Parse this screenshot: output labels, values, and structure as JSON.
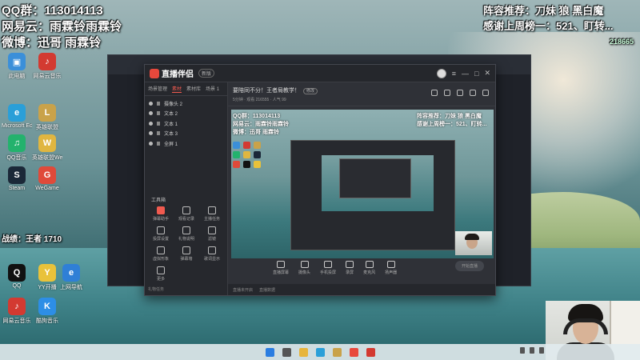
{
  "overlay": {
    "qq_group": "QQ群：113014113",
    "netease": "网易云：雨霖铃雨霖铃",
    "weibo": "微博：迅哥 雨霖铃",
    "lineup": "阵容推荐：刀妹 狼 黑白魔",
    "thanks": "感谢上周榜一：521、盯转...",
    "room_no": "218665"
  },
  "desktop_icons": [
    {
      "label": "此电脑",
      "color": "#3b8fd9",
      "glyph": "▣"
    },
    {
      "label": "网易云音乐",
      "color": "#d33a31",
      "glyph": "♪"
    },
    {
      "label": "Microsoft Edge",
      "color": "#2a9fd8",
      "glyph": "e"
    },
    {
      "label": "英雄联盟",
      "color": "#c9a24a",
      "glyph": "L"
    },
    {
      "label": "QQ音乐",
      "color": "#23b26d",
      "glyph": "♫"
    },
    {
      "label": "英雄联盟WeGame",
      "color": "#e0b640",
      "glyph": "W"
    },
    {
      "label": "Steam",
      "color": "#1b2838",
      "glyph": "S"
    },
    {
      "label": "WeGame",
      "color": "#e04a3a",
      "glyph": "G"
    },
    {
      "label": "QQ",
      "color": "#111111",
      "glyph": "Q"
    },
    {
      "label": "YY开播",
      "color": "#e9c23a",
      "glyph": "Y"
    },
    {
      "label": "上网导航",
      "color": "#2f7fd6",
      "glyph": "e"
    },
    {
      "label": "网易云音乐",
      "color": "#d33a31",
      "glyph": "♪"
    },
    {
      "label": "酷狗音乐",
      "color": "#2d8ee6",
      "glyph": "K"
    }
  ],
  "desktop_overlay_mid": "战绩：王者 1710",
  "app": {
    "logo": "直播伴侣",
    "version": "新版",
    "scene_tabs": [
      "场景管理",
      "素材",
      "素材库",
      "场景 1"
    ],
    "sources": [
      "摄像头 2",
      "文本 2",
      "文本 1",
      "文本 3",
      "全屏 1"
    ],
    "tools_title": "工具箱",
    "tools": [
      "弹幕助手",
      "观看记录",
      "主播任务",
      "投屏设置",
      "礼物说明",
      "滤镜",
      "虚拟形象",
      "弹幕墙",
      "歌词显示",
      "更多"
    ],
    "room_title": "要陪同不分！王者局教学！",
    "room_tag": "修改",
    "room_meta": "5分钟 · 观看 216555 · 人气 99",
    "bottom_tools": [
      "直播屏幕",
      "摄像头",
      "手机投屏",
      "录屏",
      "麦克风",
      "扬声器"
    ],
    "start_label": "开始直播",
    "status_items": [
      "礼物任务",
      "直播未开启",
      "直播数据"
    ]
  },
  "colors": {
    "accent": "#f05a4f",
    "panel": "#2b2d33"
  }
}
